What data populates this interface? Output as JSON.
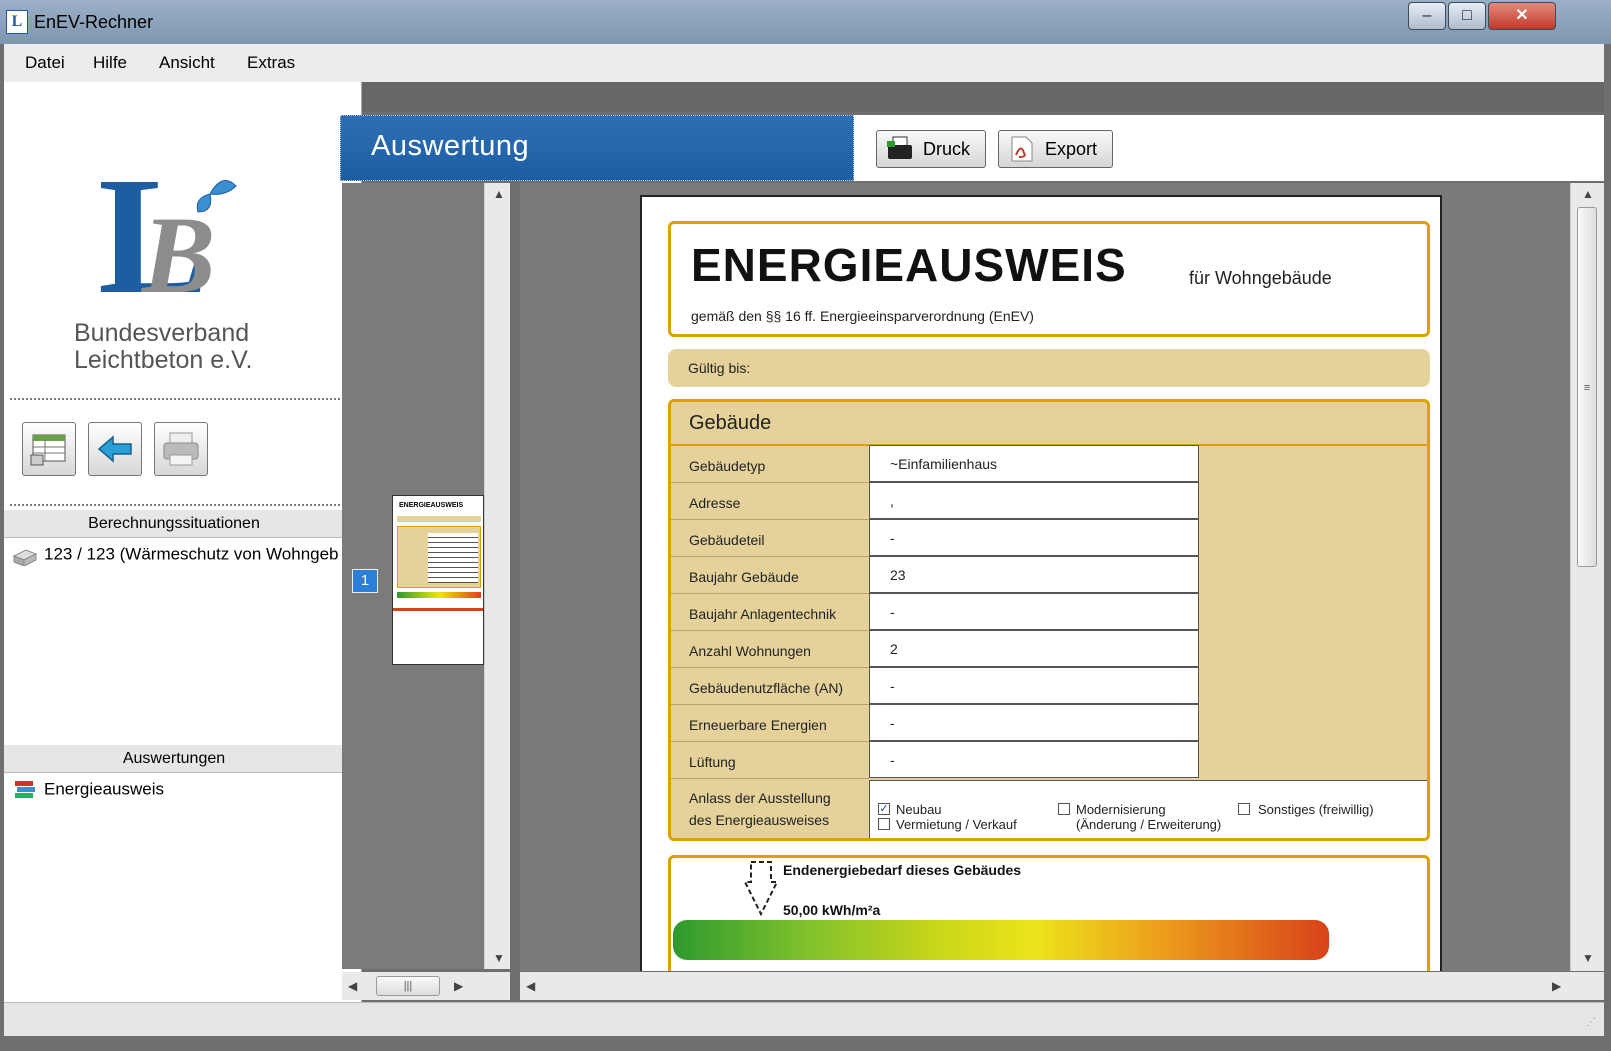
{
  "window": {
    "title": "EnEV-Rechner",
    "minimize": "–",
    "maximize": "□",
    "close": "✕"
  },
  "menu": [
    "Datei",
    "Hilfe",
    "Ansicht",
    "Extras"
  ],
  "sidebar": {
    "org_line1": "Bundesverband",
    "org_line2": "Leichtbeton e.V.",
    "section_calc": "Berechnungssituationen",
    "calc_item": "123 / 123 (Wärmeschutz von Wohngeb",
    "section_eval": "Auswertungen",
    "eval_item": "Energieausweis"
  },
  "header": {
    "title": "Auswertung",
    "print_label": "Druck",
    "export_label": "Export"
  },
  "thumbnail": {
    "page_number": "1",
    "mini_title": "ENERGIEAUSWEIS"
  },
  "document": {
    "title": "ENERGIEAUSWEIS",
    "subtitle": "für Wohngebäude",
    "law": "gemäß den §§ 16 ff. Energieeinsparverordnung (EnEV)",
    "valid_until": "Gültig bis:",
    "building_title": "Gebäude",
    "rows": [
      {
        "label": "Gebäudetyp",
        "value": "~Einfamilienhaus"
      },
      {
        "label": "Adresse",
        "value": ","
      },
      {
        "label": "Gebäudeteil",
        "value": "-"
      },
      {
        "label": "Baujahr Gebäude",
        "value": "23"
      },
      {
        "label": "Baujahr Anlagentechnik",
        "value": "-"
      },
      {
        "label": "Anzahl Wohnungen",
        "value": "2"
      },
      {
        "label": "Gebäudenutzfläche (AN)",
        "value": "-"
      },
      {
        "label": "Erneuerbare Energien",
        "value": "-"
      },
      {
        "label": "Lüftung",
        "value": "-"
      }
    ],
    "occasion_label_1": "Anlass der Ausstellung",
    "occasion_label_2": "des Energieausweises",
    "options": {
      "neubau": "Neubau",
      "vermietung": "Vermietung / Verkauf",
      "modernisierung": "Modernisierung",
      "modernisierung_detail": "(Änderung / Erweiterung)",
      "sonstiges": "Sonstiges (freiwillig)",
      "neubau_checked": true
    },
    "energy_label": "Endenergiebedarf dieses Gebäudes",
    "energy_value": "50,00 kWh/m²a"
  },
  "colors": {
    "header_blue": "#1d5ea3",
    "frame_gold": "#e0a100",
    "field_tan": "#e4d29a"
  }
}
